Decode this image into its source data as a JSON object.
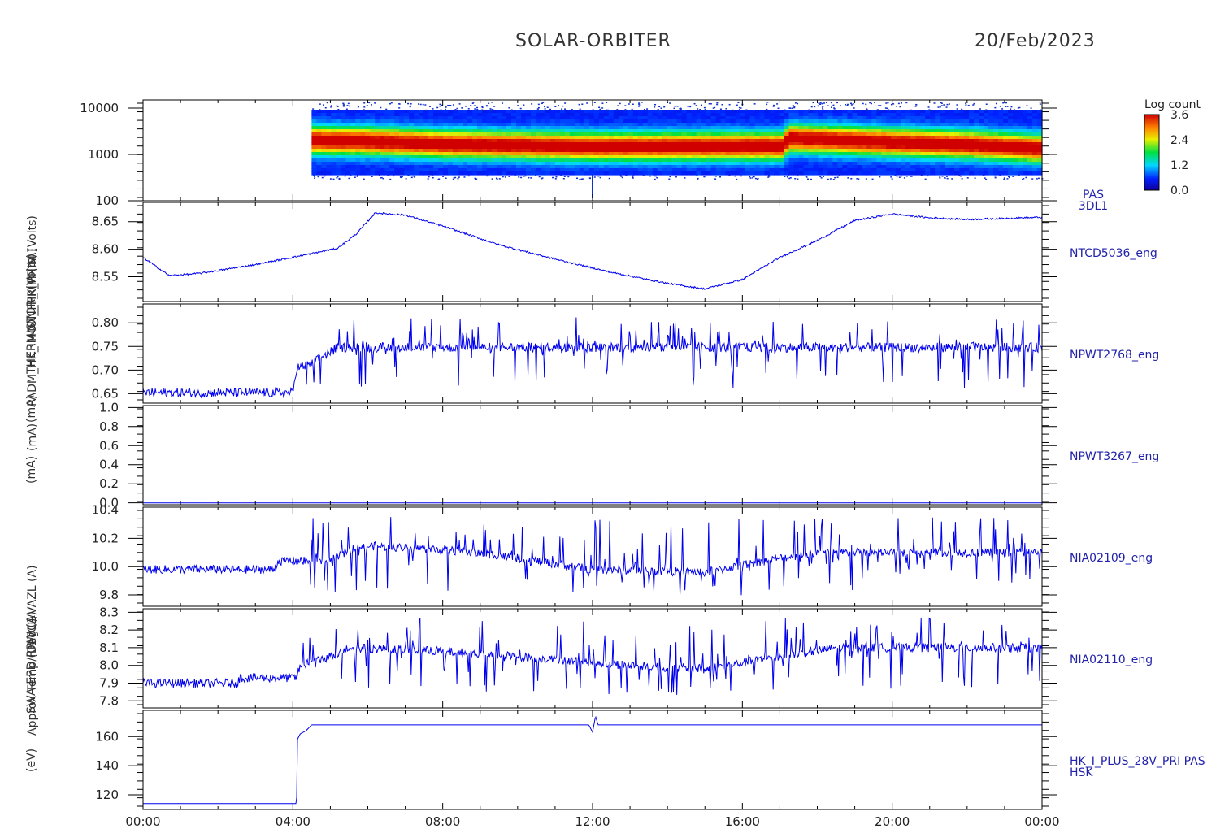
{
  "header": {
    "mission": "SOLAR-ORBITER",
    "date": "20/Feb/2023"
  },
  "y_axis_labels_overlapped": [
    "(eV)",
    "Approx Temp (DegC)",
    "SWA-EPD/RPW (A)",
    "1TCL/VAZL (A)",
    "(mA)",
    "(mA)",
    "(mA)",
    "PADM_HK_IMON_FPRIM (nA)",
    "THERMISTOR_ (Volts)",
    "IMON_HK_PRIM (Volts)"
  ],
  "colors": {
    "line": "#0000ee",
    "frame": "#000000",
    "label": "#2222aa"
  },
  "chart_data": [
    {
      "type": "heatmap",
      "panel_label": [
        "PAS",
        "3DL1"
      ],
      "ylabel": "(eV)",
      "yscale": "log",
      "ylim": [
        100,
        15000
      ],
      "yticks": [
        "10000",
        "1000",
        "100"
      ],
      "xlim_hours": [
        0,
        24
      ],
      "data_start_hour": 4.5,
      "colorbar": {
        "label": "Log count",
        "ticks": [
          "3.6",
          "2.4",
          "1.2",
          "0.0"
        ],
        "range": [
          0.0,
          3.6
        ]
      },
      "peak_energy_eV": [
        [
          4.5,
          2000
        ],
        [
          6.0,
          1900
        ],
        [
          8.0,
          1650
        ],
        [
          12.0,
          1450
        ],
        [
          17.0,
          1500
        ],
        [
          17.2,
          2200
        ],
        [
          20.0,
          1800
        ],
        [
          22.0,
          1600
        ],
        [
          24.0,
          1300
        ]
      ]
    },
    {
      "type": "line",
      "series_label": "NTCD5036_eng",
      "ylim": [
        8.505,
        8.685
      ],
      "yticks": [
        "8.65",
        "8.60",
        "8.55"
      ],
      "points": [
        [
          0,
          8.585
        ],
        [
          0.7,
          8.552
        ],
        [
          1.5,
          8.556
        ],
        [
          3.0,
          8.572
        ],
        [
          4.5,
          8.592
        ],
        [
          5.2,
          8.602
        ],
        [
          5.7,
          8.628
        ],
        [
          6.2,
          8.666
        ],
        [
          7.0,
          8.662
        ],
        [
          8.0,
          8.642
        ],
        [
          9.5,
          8.608
        ],
        [
          11.0,
          8.582
        ],
        [
          12.5,
          8.558
        ],
        [
          14.0,
          8.538
        ],
        [
          15.0,
          8.528
        ],
        [
          16.0,
          8.545
        ],
        [
          17.0,
          8.585
        ],
        [
          18.0,
          8.616
        ],
        [
          19.0,
          8.652
        ],
        [
          20.0,
          8.664
        ],
        [
          21.0,
          8.657
        ],
        [
          22.0,
          8.654
        ],
        [
          23.0,
          8.656
        ],
        [
          24.0,
          8.658
        ]
      ],
      "noise": 0.003
    },
    {
      "type": "line",
      "series_label": "NPWT2768_eng",
      "ylim": [
        0.63,
        0.84
      ],
      "yticks": [
        "0.80",
        "0.75",
        "0.70",
        "0.65"
      ],
      "points": [
        [
          0,
          0.652
        ],
        [
          4.0,
          0.652
        ],
        [
          4.1,
          0.705
        ],
        [
          4.5,
          0.712
        ],
        [
          4.8,
          0.73
        ],
        [
          5.2,
          0.748
        ],
        [
          24.0,
          0.748
        ]
      ],
      "noise": 0.02,
      "spike_max": 0.82
    },
    {
      "type": "line",
      "series_label": "NPWT3267_eng",
      "ylim": [
        -0.02,
        1.02
      ],
      "yticks": [
        "1.0",
        "0.8",
        "0.6",
        "0.4",
        "0.2",
        "0.0"
      ],
      "points": [
        [
          0,
          0.0
        ],
        [
          24.0,
          0.0
        ]
      ],
      "noise": 0.0
    },
    {
      "type": "line",
      "series_label": "NIA02109_eng",
      "ylim": [
        9.72,
        10.42
      ],
      "yticks": [
        "10.4",
        "10.2",
        "10.0",
        "9.8"
      ],
      "points": [
        [
          0,
          9.98
        ],
        [
          3.5,
          9.98
        ],
        [
          3.6,
          10.04
        ],
        [
          5.0,
          10.04
        ],
        [
          5.4,
          10.1
        ],
        [
          5.8,
          10.15
        ],
        [
          8.0,
          10.12
        ],
        [
          9.5,
          10.08
        ],
        [
          12.0,
          9.98
        ],
        [
          15.0,
          9.96
        ],
        [
          17.0,
          10.06
        ],
        [
          18.0,
          10.1
        ],
        [
          24.0,
          10.1
        ]
      ],
      "noise": 0.06,
      "spike_max": 10.38
    },
    {
      "type": "line",
      "series_label": "NIA02110_eng",
      "ylim": [
        7.76,
        8.32
      ],
      "yticks": [
        "8.3",
        "8.2",
        "8.1",
        "8.0",
        "7.9",
        "7.8"
      ],
      "points": [
        [
          0,
          7.9
        ],
        [
          2.5,
          7.9
        ],
        [
          2.6,
          7.93
        ],
        [
          4.1,
          7.93
        ],
        [
          4.2,
          8.0
        ],
        [
          5.0,
          8.05
        ],
        [
          5.5,
          8.1
        ],
        [
          8.0,
          8.08
        ],
        [
          10.0,
          8.05
        ],
        [
          13.0,
          8.0
        ],
        [
          15.0,
          7.98
        ],
        [
          17.0,
          8.05
        ],
        [
          18.5,
          8.1
        ],
        [
          24.0,
          8.1
        ]
      ],
      "noise": 0.05,
      "spike_max": 8.29
    },
    {
      "type": "line",
      "series_label": "HK_I_PLUS_28V_PRI PAS",
      "series_label_2": "HSK",
      "ylim": [
        110,
        178
      ],
      "yticks": [
        "160",
        "140",
        "120"
      ],
      "points": [
        [
          0,
          114
        ],
        [
          4.1,
          114
        ],
        [
          4.12,
          158
        ],
        [
          4.2,
          162
        ],
        [
          4.35,
          164
        ],
        [
          4.5,
          168
        ],
        [
          11.9,
          168
        ],
        [
          12.0,
          163
        ],
        [
          12.08,
          174
        ],
        [
          12.15,
          168
        ],
        [
          24.0,
          168
        ]
      ],
      "noise": 0.0
    }
  ],
  "x_axis": {
    "ticks": [
      "00:00",
      "04:00",
      "08:00",
      "12:00",
      "16:00",
      "20:00",
      "00:00"
    ],
    "range_hours": [
      0,
      24
    ]
  }
}
